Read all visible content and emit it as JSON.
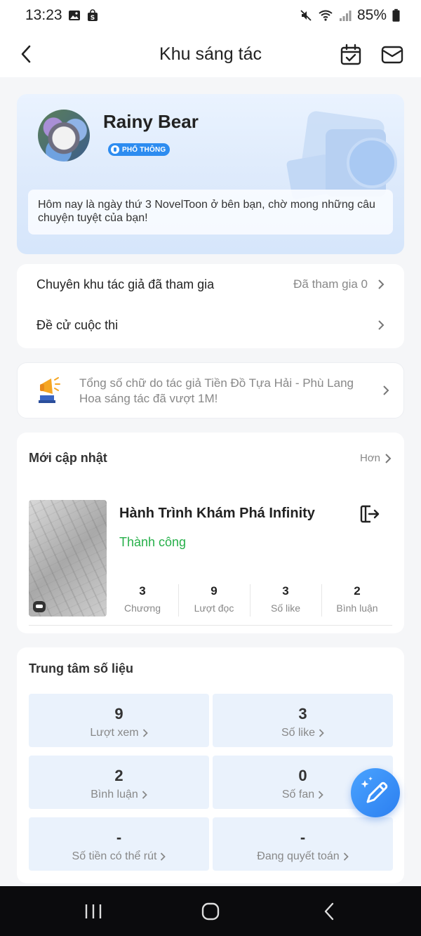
{
  "status_bar": {
    "time": "13:23",
    "battery": "85%",
    "left_icons": [
      "gallery-icon",
      "shop-icon"
    ],
    "right_icons": [
      "mute-icon",
      "wifi-icon",
      "signal-icon",
      "battery-icon"
    ]
  },
  "header": {
    "title": "Khu sáng tác",
    "back_icon": "back-arrow-icon",
    "calendar_icon": "calendar-check-icon",
    "mail_icon": "mail-icon"
  },
  "profile": {
    "name": "Rainy Bear",
    "badge": "PHỔ THÔNG",
    "greeting": "Hôm nay là ngày thứ 3 NovelToon ở bên bạn, chờ mong những câu chuyện tuyệt của bạn!"
  },
  "menu": {
    "items": [
      {
        "label": "Chuyên khu tác giả đã tham gia",
        "meta": "Đã tham gia 0"
      },
      {
        "label": "Đề cử cuộc thi",
        "meta": ""
      }
    ]
  },
  "notice": {
    "icon": "megaphone-icon",
    "text": "Tổng số chữ do tác giả Tiền Đồ Tựa Hải - Phù Lang Hoa sáng tác đã vượt 1M!"
  },
  "recent": {
    "title": "Mới cập nhật",
    "more": "Hơn",
    "book": {
      "title": "Hành Trình Khám Phá Infinity",
      "status": "Thành công",
      "stats": [
        {
          "value": "3",
          "label": "Chương"
        },
        {
          "value": "9",
          "label": "Lượt đọc"
        },
        {
          "value": "3",
          "label": "Số like"
        },
        {
          "value": "2",
          "label": "Bình luận"
        }
      ]
    }
  },
  "data_center": {
    "title": "Trung tâm số liệu",
    "tiles": [
      {
        "value": "9",
        "label": "Lượt xem"
      },
      {
        "value": "3",
        "label": "Số like"
      },
      {
        "value": "2",
        "label": "Bình luận"
      },
      {
        "value": "0",
        "label": "Số fan"
      },
      {
        "value": "-",
        "label": "Số tiền có thể rút"
      },
      {
        "value": "-",
        "label": "Đang quyết toán"
      }
    ]
  },
  "colors": {
    "accent": "#2d8cf0",
    "success": "#27b04a",
    "tile_bg": "#eaf2fc"
  }
}
